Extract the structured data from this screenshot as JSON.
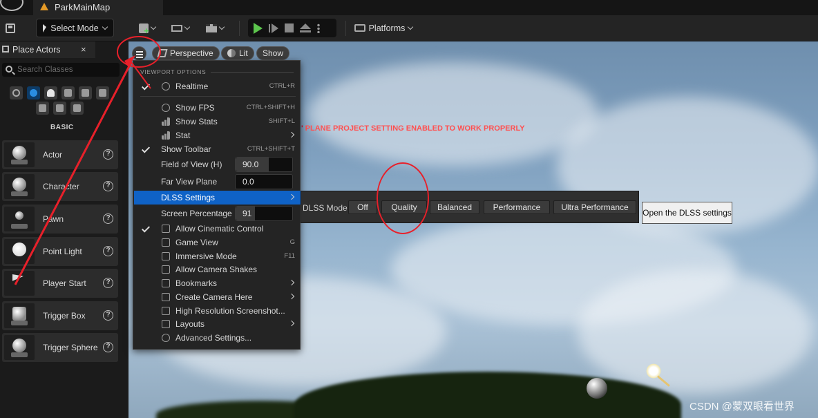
{
  "window": {
    "doc_tab": "ParkMainMap"
  },
  "toolbar": {
    "select_mode": "Select Mode",
    "platforms": "Platforms"
  },
  "place_actors": {
    "tab_label": "Place Actors",
    "close": "×",
    "search_placeholder": "Search Classes",
    "category_title": "BASIC",
    "items": [
      {
        "label": "Actor",
        "icon": "sphere-on-base-icon"
      },
      {
        "label": "Character",
        "icon": "character-head-icon"
      },
      {
        "label": "Pawn",
        "icon": "pawn-icon"
      },
      {
        "label": "Point Light",
        "icon": "light-bulb-icon"
      },
      {
        "label": "Player Start",
        "icon": "flag-gamepad-icon"
      },
      {
        "label": "Trigger Box",
        "icon": "trigger-box-icon"
      },
      {
        "label": "Trigger Sphere",
        "icon": "trigger-sphere-icon"
      }
    ]
  },
  "viewport": {
    "perspective": "Perspective",
    "lit": "Lit",
    "show": "Show",
    "warning_text": "PLANE PROJECT SETTING ENABLED TO WORK PROPERLY",
    "watermark": "CSDN @蒙双眼看世界"
  },
  "viewport_options": {
    "header": "VIEWPORT OPTIONS",
    "realtime": {
      "label": "Realtime",
      "shortcut": "CTRL+R"
    },
    "show_fps": {
      "label": "Show FPS",
      "shortcut": "CTRL+SHIFT+H"
    },
    "show_stats": {
      "label": "Show Stats",
      "shortcut": "SHIFT+L"
    },
    "stat": {
      "label": "Stat"
    },
    "show_toolbar": {
      "label": "Show Toolbar",
      "shortcut": "CTRL+SHIFT+T"
    },
    "fov": {
      "label": "Field of View (H)",
      "value": "90.0"
    },
    "far_view": {
      "label": "Far View Plane",
      "value": "0.0"
    },
    "dlss": {
      "label": "DLSS Settings"
    },
    "screen_pct": {
      "label": "Screen Percentage",
      "value": "91"
    },
    "cinematic": {
      "label": "Allow Cinematic Control"
    },
    "game_view": {
      "label": "Game View",
      "shortcut": "G"
    },
    "immersive": {
      "label": "Immersive Mode",
      "shortcut": "F11"
    },
    "camera_shakes": {
      "label": "Allow Camera Shakes"
    },
    "bookmarks": {
      "label": "Bookmarks"
    },
    "create_camera": {
      "label": "Create Camera Here"
    },
    "hires_screenshot": {
      "label": "High Resolution Screenshot..."
    },
    "layouts": {
      "label": "Layouts"
    },
    "advanced": {
      "label": "Advanced Settings..."
    }
  },
  "dlss_submenu": {
    "label": "DLSS Mode",
    "options": [
      "Off",
      "Quality",
      "Balanced",
      "Performance",
      "Ultra Performance"
    ],
    "tooltip": "Open the DLSS settings"
  },
  "colors": {
    "highlight": "#0f62c6",
    "annotation": "#e8202a",
    "play_green": "#5cc54d",
    "warning_red": "#c8102e"
  }
}
